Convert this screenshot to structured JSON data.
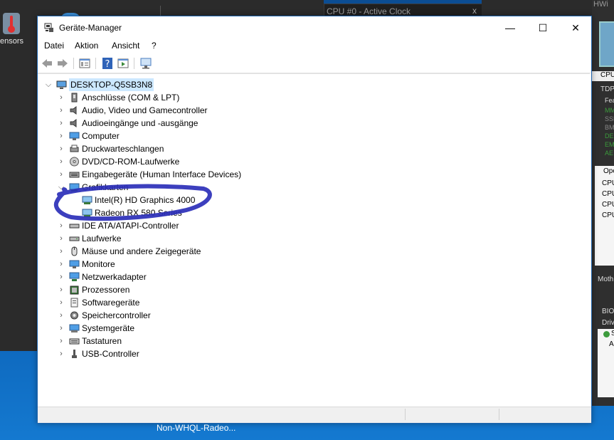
{
  "hwinfo_left": {
    "sensors_label": "ensors"
  },
  "cpu_clock_window": {
    "title": "CPU #0 - Active Clock",
    "close": "x"
  },
  "hwinfo_right": {
    "title": "HWi",
    "labels": [
      "CPU",
      "TDP",
      "Fea",
      "MM",
      "SSE",
      "BM",
      "DE",
      "EM",
      "AE",
      "Ope",
      "CPU",
      "CPU",
      "CPU",
      "CPU",
      "Moth",
      "BIO",
      "Driv",
      "S",
      "A"
    ]
  },
  "window": {
    "title": "Geräte-Manager",
    "minimize": "—",
    "maximize": "☐",
    "close": "✕"
  },
  "menu": [
    "Datei",
    "Aktion",
    "Ansicht",
    "?"
  ],
  "tree": {
    "root": "DESKTOP-Q5SB3N8",
    "categories": [
      {
        "label": "Anschlüsse (COM & LPT)",
        "icon": "port-icon"
      },
      {
        "label": "Audio, Video und Gamecontroller",
        "icon": "speaker-icon"
      },
      {
        "label": "Audioeingänge und -ausgänge",
        "icon": "speaker-icon"
      },
      {
        "label": "Computer",
        "icon": "monitor-icon"
      },
      {
        "label": "Druckwarteschlangen",
        "icon": "printer-icon"
      },
      {
        "label": "DVD/CD-ROM-Laufwerke",
        "icon": "disc-icon"
      },
      {
        "label": "Eingabegeräte (Human Interface Devices)",
        "icon": "hid-icon"
      },
      {
        "label": "Grafikkarten",
        "icon": "display-adapter-icon",
        "expanded": true,
        "children": [
          "Intel(R) HD Graphics 4000",
          "Radeon RX 580 Series"
        ]
      },
      {
        "label": "IDE ATA/ATAPI-Controller",
        "icon": "ide-icon"
      },
      {
        "label": "Laufwerke",
        "icon": "drive-icon"
      },
      {
        "label": "Mäuse und andere Zeigegeräte",
        "icon": "mouse-icon"
      },
      {
        "label": "Monitore",
        "icon": "monitor-icon"
      },
      {
        "label": "Netzwerkadapter",
        "icon": "network-icon"
      },
      {
        "label": "Prozessoren",
        "icon": "cpu-icon"
      },
      {
        "label": "Softwaregeräte",
        "icon": "software-device-icon"
      },
      {
        "label": "Speichercontroller",
        "icon": "storage-controller-icon"
      },
      {
        "label": "Systemgeräte",
        "icon": "system-device-icon"
      },
      {
        "label": "Tastaturen",
        "icon": "keyboard-icon"
      },
      {
        "label": "USB-Controller",
        "icon": "usb-icon"
      }
    ]
  },
  "taskbar": {
    "item": "Non-WHQL-Radeo..."
  },
  "colors": {
    "selection": "#cce8ff",
    "annotation": "#2b2fb8",
    "window_border": "#1d63ad"
  }
}
